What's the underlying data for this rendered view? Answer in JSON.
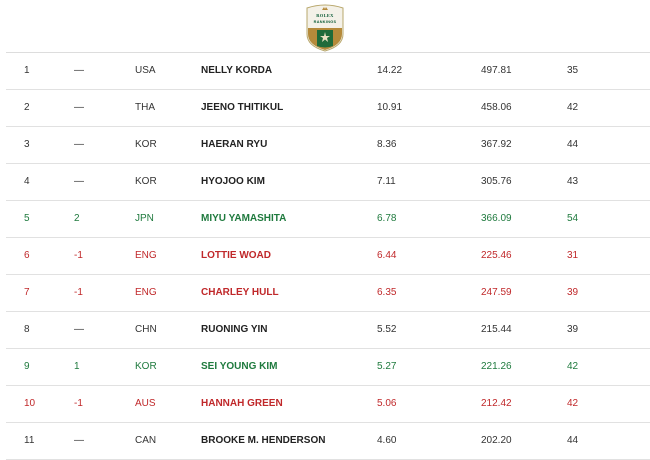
{
  "logo": {
    "brand": "ROLEX",
    "subtitle": "RANKINGS"
  },
  "colors": {
    "neutral": "#333333",
    "up": "#1f7a3e",
    "down": "#c0282a"
  },
  "rows": [
    {
      "rank": "1",
      "move": "—",
      "country": "USA",
      "name": "NELLY KORDA",
      "avg": "14.22",
      "total": "497.81",
      "events": "35",
      "trend": "neutral"
    },
    {
      "rank": "2",
      "move": "—",
      "country": "THA",
      "name": "JEENO THITIKUL",
      "avg": "10.91",
      "total": "458.06",
      "events": "42",
      "trend": "neutral"
    },
    {
      "rank": "3",
      "move": "—",
      "country": "KOR",
      "name": "HAERAN RYU",
      "avg": "8.36",
      "total": "367.92",
      "events": "44",
      "trend": "neutral"
    },
    {
      "rank": "4",
      "move": "—",
      "country": "KOR",
      "name": "HYOJOO KIM",
      "avg": "7.11",
      "total": "305.76",
      "events": "43",
      "trend": "neutral"
    },
    {
      "rank": "5",
      "move": "2",
      "country": "JPN",
      "name": "MIYU YAMASHITA",
      "avg": "6.78",
      "total": "366.09",
      "events": "54",
      "trend": "up"
    },
    {
      "rank": "6",
      "move": "-1",
      "country": "ENG",
      "name": "LOTTIE WOAD",
      "avg": "6.44",
      "total": "225.46",
      "events": "31",
      "trend": "down"
    },
    {
      "rank": "7",
      "move": "-1",
      "country": "ENG",
      "name": "CHARLEY HULL",
      "avg": "6.35",
      "total": "247.59",
      "events": "39",
      "trend": "down"
    },
    {
      "rank": "8",
      "move": "—",
      "country": "CHN",
      "name": "RUONING YIN",
      "avg": "5.52",
      "total": "215.44",
      "events": "39",
      "trend": "neutral"
    },
    {
      "rank": "9",
      "move": "1",
      "country": "KOR",
      "name": "SEI YOUNG KIM",
      "avg": "5.27",
      "total": "221.26",
      "events": "42",
      "trend": "up"
    },
    {
      "rank": "10",
      "move": "-1",
      "country": "AUS",
      "name": "HANNAH GREEN",
      "avg": "5.06",
      "total": "212.42",
      "events": "42",
      "trend": "down"
    },
    {
      "rank": "11",
      "move": "—",
      "country": "CAN",
      "name": "BROOKE M. HENDERSON",
      "avg": "4.60",
      "total": "202.20",
      "events": "44",
      "trend": "neutral"
    }
  ]
}
